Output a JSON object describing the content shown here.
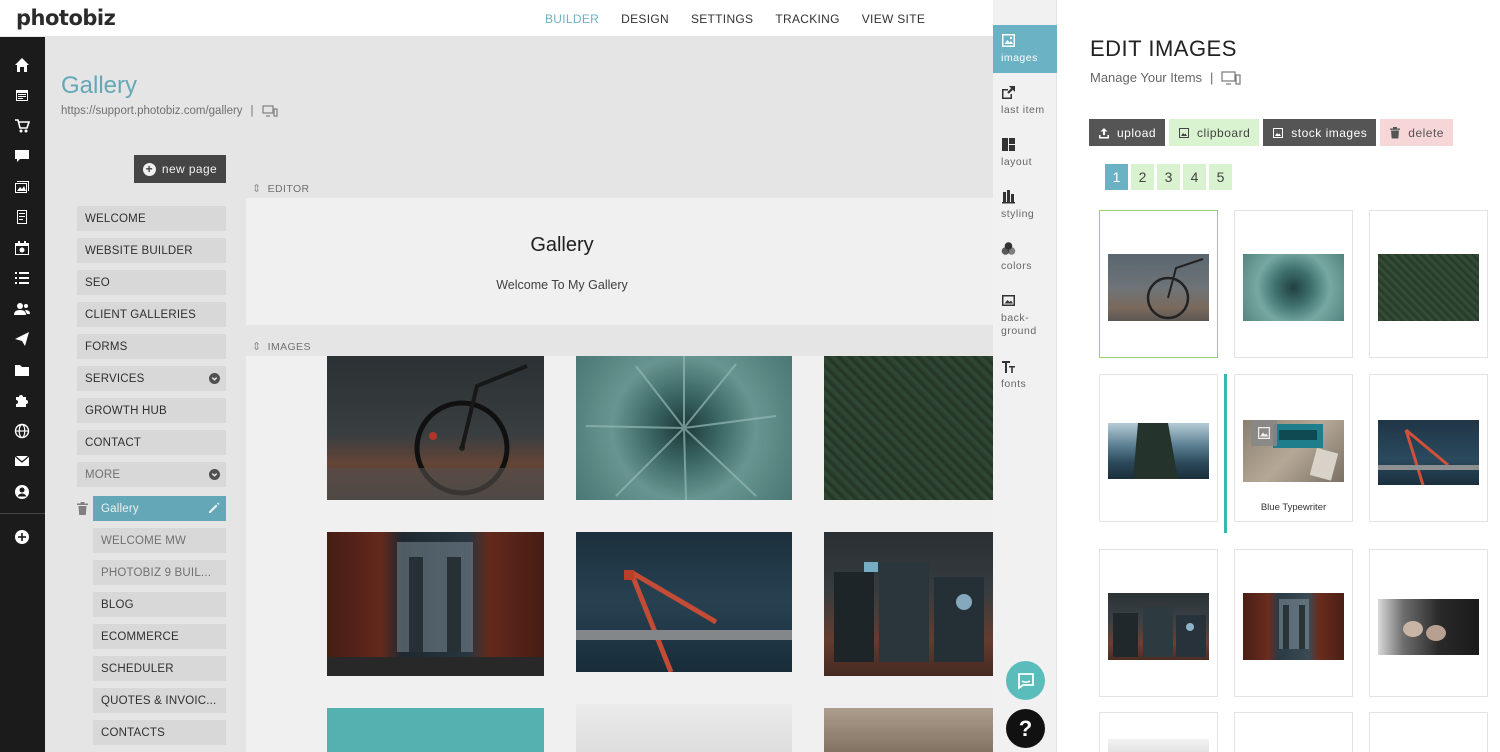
{
  "app": {
    "logo": "photobiz"
  },
  "topnav": [
    {
      "label": "BUILDER",
      "active": true
    },
    {
      "label": "DESIGN",
      "active": false
    },
    {
      "label": "SETTINGS",
      "active": false
    },
    {
      "label": "TRACKING",
      "active": false
    },
    {
      "label": "VIEW SITE",
      "active": false
    }
  ],
  "rail_icons": [
    "home-icon",
    "calendar-icon",
    "cart-icon",
    "comment-icon",
    "gallery-icon",
    "document-icon",
    "schedule-icon",
    "list-icon",
    "users-icon",
    "send-icon",
    "folder-icon",
    "puzzle-icon",
    "globe-icon",
    "mail-icon",
    "account-icon",
    "add-circle-icon"
  ],
  "page": {
    "title": "Gallery",
    "url": "https://support.photobiz.com/gallery",
    "separator": "|",
    "new_page_label": "new page"
  },
  "nav": {
    "items": [
      {
        "label": "WELCOME"
      },
      {
        "label": "WEBSITE BUILDER"
      },
      {
        "label": "SEO"
      },
      {
        "label": "CLIENT GALLERIES"
      },
      {
        "label": "FORMS"
      },
      {
        "label": "SERVICES"
      },
      {
        "label": "GROWTH HUB"
      },
      {
        "label": "CONTACT"
      },
      {
        "label": "MORE"
      }
    ],
    "sub_items": [
      {
        "label": "Gallery"
      },
      {
        "label": "WELCOME MW"
      },
      {
        "label": "PHOTOBIZ 9 BUIL..."
      },
      {
        "label": "BLOG"
      },
      {
        "label": "ECOMMERCE"
      },
      {
        "label": "SCHEDULER"
      },
      {
        "label": "QUOTES & INVOIC..."
      },
      {
        "label": "CONTACTS"
      }
    ]
  },
  "editor": {
    "section_label": "EDITOR",
    "title": "Gallery",
    "subtitle": "Welcome To My Gallery",
    "images_label": "IMAGES"
  },
  "sidetabs": [
    {
      "label": "images",
      "icon": "image-icon",
      "active": true
    },
    {
      "label": "last item",
      "icon": "share-icon",
      "active": false
    },
    {
      "label": "layout",
      "icon": "layout-icon",
      "active": false
    },
    {
      "label": "styling",
      "icon": "styling-icon",
      "active": false
    },
    {
      "label": "colors",
      "icon": "colors-icon",
      "active": false
    },
    {
      "label": "back-ground",
      "icon": "background-icon",
      "active": false
    },
    {
      "label": "fonts",
      "icon": "fonts-icon",
      "active": false
    }
  ],
  "panel": {
    "title": "EDIT IMAGES",
    "subtitle": "Manage Your Items",
    "separator": "|",
    "actions": {
      "upload": "upload",
      "clipboard": "clipboard",
      "stock": "stock images",
      "delete": "delete"
    },
    "pages": [
      "1",
      "2",
      "3",
      "4",
      "5"
    ],
    "active_page": "1",
    "items": [
      {
        "subject": "bicycle",
        "caption": ""
      },
      {
        "subject": "succulent",
        "caption": ""
      },
      {
        "subject": "forest",
        "caption": ""
      },
      {
        "subject": "coast",
        "caption": ""
      },
      {
        "subject": "typewriter",
        "caption": "Blue Typewriter"
      },
      {
        "subject": "bridge-aerial",
        "caption": ""
      },
      {
        "subject": "suitcases",
        "caption": ""
      },
      {
        "subject": "manhattan-bridge",
        "caption": ""
      },
      {
        "subject": "hands",
        "caption": ""
      }
    ]
  },
  "colors": {
    "accent": "#6bb3c4",
    "rail": "#1b1b1b",
    "green_btn": "#d9f2cf",
    "red_btn": "#f6d6d6",
    "chat": "#5bbdbb"
  }
}
